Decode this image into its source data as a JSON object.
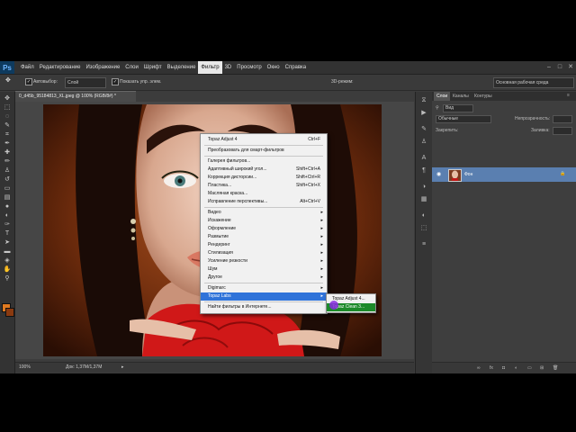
{
  "menubar": {
    "items": [
      "Файл",
      "Редактирование",
      "Изображение",
      "Слои",
      "Шрифт",
      "Выделение",
      "Фильтр",
      "3D",
      "Просмотр",
      "Окно",
      "Справка"
    ],
    "active": "Фильтр",
    "app_logo": "Ps"
  },
  "options": {
    "autoselect_label": "Автовыбор:",
    "autoselect_value": "Слой",
    "show_controls_label": "Показать упр. элем.",
    "mode_label": "3D-режим:",
    "workspace": "Основная рабочая среда"
  },
  "document": {
    "tab_title": "0_d45b_95184813_XL.jpeg @ 100% (RGB/8#) *",
    "zoom": "100%",
    "doc_info": "Док: 1,37M/1,37M"
  },
  "filter_menu": {
    "items": [
      {
        "label": "Topaz Adjust 4",
        "shortcut": "Ctrl+F"
      },
      {
        "separator": true
      },
      {
        "label": "Преобразовать для смарт-фильтров"
      },
      {
        "separator": true
      },
      {
        "label": "Галерея фильтров..."
      },
      {
        "label": "Адаптивный широкий угол...",
        "shortcut": "Shift+Ctrl+A"
      },
      {
        "label": "Коррекция дисторсии...",
        "shortcut": "Shift+Ctrl+R"
      },
      {
        "label": "Пластика...",
        "shortcut": "Shift+Ctrl+X"
      },
      {
        "label": "Масляная краска..."
      },
      {
        "label": "Исправление перспективы...",
        "shortcut": "Alt+Ctrl+V"
      },
      {
        "separator": true
      },
      {
        "label": "Видео",
        "submenu": true
      },
      {
        "label": "Искажение",
        "submenu": true
      },
      {
        "label": "Оформление",
        "submenu": true
      },
      {
        "label": "Размытие",
        "submenu": true
      },
      {
        "label": "Рендеринг",
        "submenu": true
      },
      {
        "label": "Стилизация",
        "submenu": true
      },
      {
        "label": "Усиление резкости",
        "submenu": true
      },
      {
        "label": "Шум",
        "submenu": true
      },
      {
        "label": "Другое",
        "submenu": true
      },
      {
        "separator": true
      },
      {
        "label": "Digimarc",
        "submenu": true
      },
      {
        "label": "Topaz Labs",
        "submenu": true,
        "highlighted": true
      },
      {
        "separator": true
      },
      {
        "label": "Найти фильтры в Интернете..."
      }
    ]
  },
  "topaz_submenu": {
    "items": [
      {
        "label": "Topaz Adjust 4..."
      },
      {
        "label": "Topaz Clean 3...",
        "highlighted": true
      }
    ]
  },
  "panels": {
    "tabs": [
      "Слои",
      "Каналы",
      "Контуры"
    ],
    "active_tab": "Слои",
    "kind_label": "Вид",
    "blend_mode": "Обычные",
    "opacity_label": "Непрозрачность:",
    "lock_label": "Закрепить:",
    "fill_label": "Заливка:",
    "layer_name": "Фон"
  },
  "colors": {
    "accent_highlight": "#2f73d9",
    "submenu_highlight": "#1d8a2a",
    "foreground_swatch": "#e07a20",
    "background_swatch": "#8a3a10"
  }
}
